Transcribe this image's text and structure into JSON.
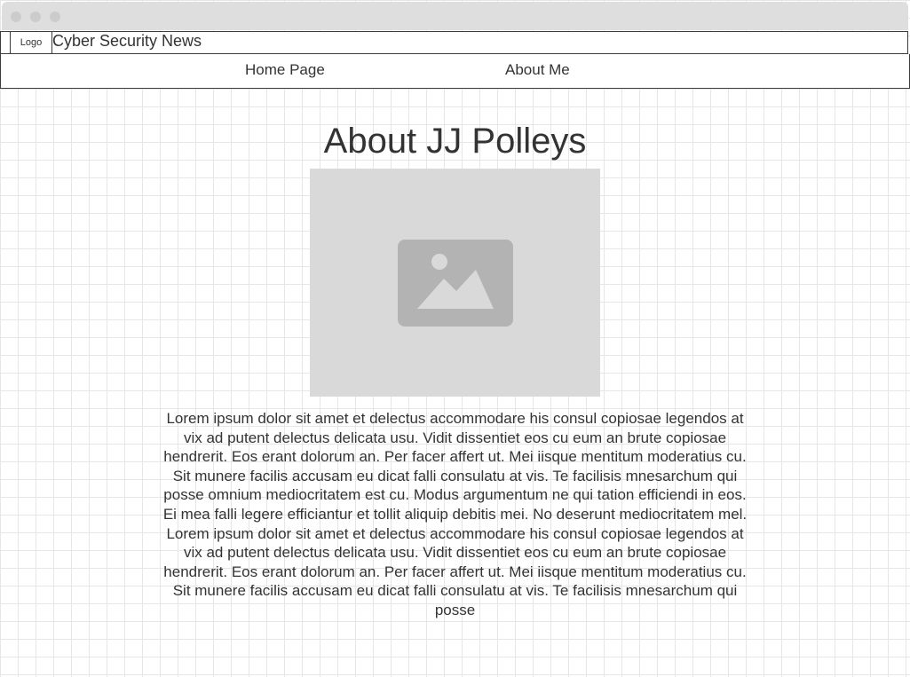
{
  "header": {
    "logo_label": "Logo",
    "site_title": "Cyber Security News"
  },
  "nav": {
    "items": [
      {
        "label": "Home Page"
      },
      {
        "label": "About Me"
      }
    ]
  },
  "main": {
    "heading": "About JJ Polleys",
    "image_icon": "image-icon",
    "bio": "Lorem ipsum dolor sit amet et delectus accommodare his consul copiosae legendos at vix ad putent delectus delicata usu. Vidit dissentiet eos cu eum an brute copiosae hendrerit. Eos erant dolorum an. Per facer affert ut. Mei iisque mentitum moderatius cu. Sit munere facilis accusam eu dicat falli consulatu at vis. Te facilisis mnesarchum qui posse omnium mediocritatem est cu. Modus argumentum ne qui tation efficiendi in eos. Ei mea falli legere efficiantur et tollit aliquip debitis mei. No deserunt mediocritatem mel. Lorem ipsum dolor sit amet et delectus accommodare his consul copiosae legendos at vix ad putent delectus delicata usu. Vidit dissentiet eos cu eum an brute copiosae hendrerit. Eos erant dolorum an. Per facer affert ut. Mei iisque mentitum moderatius cu. Sit munere facilis accusam eu dicat falli consulatu at vis. Te facilisis mnesarchum qui posse"
  },
  "colors": {
    "text": "#333333",
    "border": "#3c3c3c",
    "placeholder_bg": "#d9d9d9",
    "placeholder_icon": "#b3b3b3",
    "grid": "#e6e6e6"
  }
}
